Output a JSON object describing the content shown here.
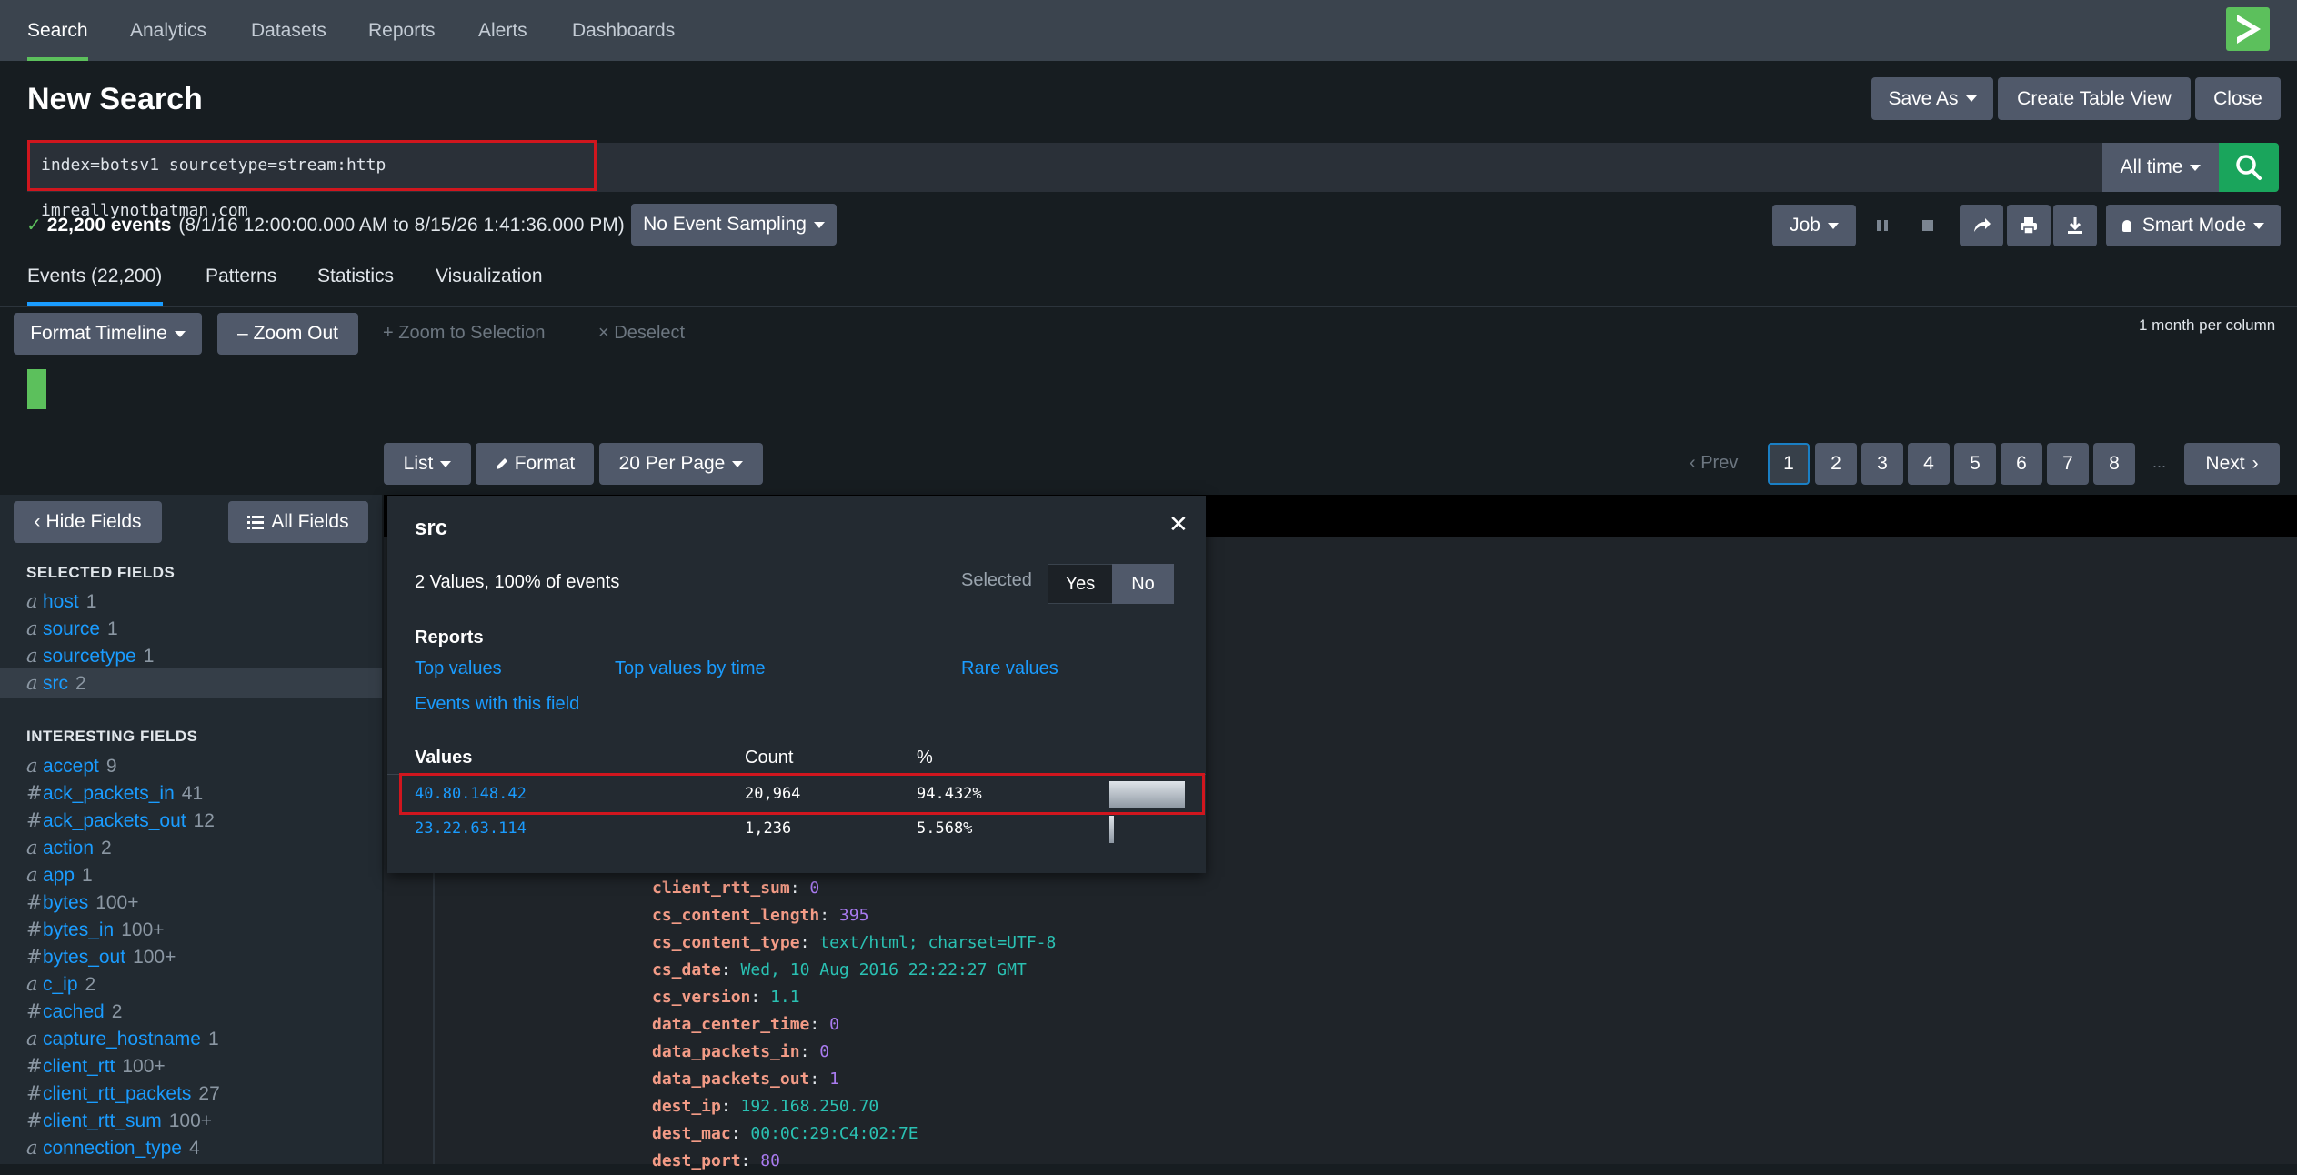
{
  "nav": {
    "items": [
      "Search",
      "Analytics",
      "Datasets",
      "Reports",
      "Alerts",
      "Dashboards"
    ]
  },
  "page_title": "New Search",
  "header_buttons": {
    "save_as": "Save As",
    "create_table_view": "Create Table View",
    "close": "Close"
  },
  "search": {
    "query": "index=botsv1 sourcetype=stream:http imreallynotbatman.com",
    "time_range": "All time"
  },
  "status": {
    "count": "22,200 events",
    "range": "(8/1/16 12:00:00.000 AM to 8/15/26 1:41:36.000 PM)",
    "sampling": "No Event Sampling",
    "job": "Job",
    "mode": "Smart Mode"
  },
  "tabs": [
    "Events (22,200)",
    "Patterns",
    "Statistics",
    "Visualization"
  ],
  "timeline": {
    "format": "Format Timeline",
    "zoom_out": "Zoom Out",
    "zoom_selection": "Zoom to Selection",
    "deselect": "Deselect",
    "scale": "1 month per column"
  },
  "results_toolbar": {
    "list": "List",
    "format": "Format",
    "per_page": "20 Per Page",
    "prev": "Prev",
    "next": "Next",
    "pages": [
      "1",
      "2",
      "3",
      "4",
      "5",
      "6",
      "7",
      "8"
    ],
    "ellipsis": "..."
  },
  "sidebar": {
    "hide_fields": "Hide Fields",
    "all_fields": "All Fields",
    "selected_header": "SELECTED FIELDS",
    "selected": [
      {
        "type": "a",
        "name": "host",
        "count": "1"
      },
      {
        "type": "a",
        "name": "source",
        "count": "1"
      },
      {
        "type": "a",
        "name": "sourcetype",
        "count": "1"
      },
      {
        "type": "a",
        "name": "src",
        "count": "2"
      }
    ],
    "interesting_header": "INTERESTING FIELDS",
    "interesting": [
      {
        "type": "a",
        "name": "accept",
        "count": "9"
      },
      {
        "type": "#",
        "name": "ack_packets_in",
        "count": "41"
      },
      {
        "type": "#",
        "name": "ack_packets_out",
        "count": "12"
      },
      {
        "type": "a",
        "name": "action",
        "count": "2"
      },
      {
        "type": "a",
        "name": "app",
        "count": "1"
      },
      {
        "type": "#",
        "name": "bytes",
        "count": "100+"
      },
      {
        "type": "#",
        "name": "bytes_in",
        "count": "100+"
      },
      {
        "type": "#",
        "name": "bytes_out",
        "count": "100+"
      },
      {
        "type": "a",
        "name": "c_ip",
        "count": "2"
      },
      {
        "type": "#",
        "name": "cached",
        "count": "2"
      },
      {
        "type": "a",
        "name": "capture_hostname",
        "count": "1"
      },
      {
        "type": "#",
        "name": "client_rtt",
        "count": "100+"
      },
      {
        "type": "#",
        "name": "client_rtt_packets",
        "count": "27"
      },
      {
        "type": "#",
        "name": "client_rtt_sum",
        "count": "100+"
      },
      {
        "type": "a",
        "name": "connection_type",
        "count": "4"
      }
    ]
  },
  "event_fields": [
    {
      "key": "client_rtt_sum",
      "value": "0",
      "kind": "num"
    },
    {
      "key": "cs_content_length",
      "value": "395",
      "kind": "num"
    },
    {
      "key": "cs_content_type",
      "value": "text/html; charset=UTF-8",
      "kind": "str"
    },
    {
      "key": "cs_date",
      "value": "Wed, 10 Aug 2016 22:22:27 GMT",
      "kind": "str"
    },
    {
      "key": "cs_version",
      "value": "1.1",
      "kind": "str"
    },
    {
      "key": "data_center_time",
      "value": "0",
      "kind": "num"
    },
    {
      "key": "data_packets_in",
      "value": "0",
      "kind": "num"
    },
    {
      "key": "data_packets_out",
      "value": "1",
      "kind": "num"
    },
    {
      "key": "dest_ip",
      "value": "192.168.250.70",
      "kind": "str"
    },
    {
      "key": "dest_mac",
      "value": "00:0C:29:C4:02:7E",
      "kind": "str"
    },
    {
      "key": "dest_port",
      "value": "80",
      "kind": "num"
    }
  ],
  "popup": {
    "field": "src",
    "summary": "2 Values, 100% of events",
    "selected_label": "Selected",
    "yes": "Yes",
    "no": "No",
    "reports_header": "Reports",
    "top_values": "Top values",
    "top_values_time": "Top values by time",
    "rare_values": "Rare values",
    "events_with_field": "Events with this field",
    "col_values": "Values",
    "col_count": "Count",
    "col_pct": "%",
    "rows": [
      {
        "value": "40.80.148.42",
        "count": "20,964",
        "pct": "94.432%",
        "share": 0.94432
      },
      {
        "value": "23.22.63.114",
        "count": "1,236",
        "pct": "5.568%",
        "share": 0.05568
      }
    ]
  },
  "colors": {
    "accent_green": "#5cc05c",
    "search_button": "#1aa55c",
    "link_blue": "#1a9cff",
    "highlight_red": "#d0161e"
  },
  "icons": [
    "logo-icon",
    "search-icon",
    "check-icon",
    "pause-icon",
    "stop-icon",
    "share-icon",
    "print-icon",
    "export-icon",
    "bulb-icon",
    "close-icon",
    "list-icon",
    "pencil-icon",
    "chevron-left-icon",
    "chevron-right-icon"
  ]
}
